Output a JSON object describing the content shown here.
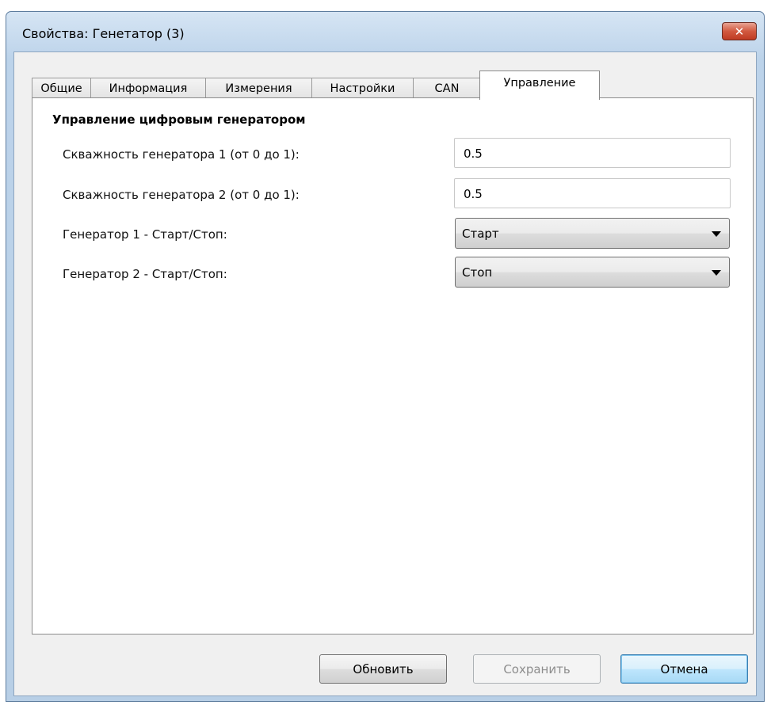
{
  "window": {
    "title": "Свойства: Генетатор (3)",
    "close_label": "✕"
  },
  "tabs": [
    {
      "label": "Общие"
    },
    {
      "label": "Информация"
    },
    {
      "label": "Измерения"
    },
    {
      "label": "Настройки"
    },
    {
      "label": "CAN"
    },
    {
      "label": "Управление",
      "active": true
    }
  ],
  "panel": {
    "section_title": "Управление цифровым генератором",
    "fields": [
      {
        "label": "Скважность генератора 1 (от 0 до 1):",
        "value": "0.5"
      },
      {
        "label": "Скважность генератора 2 (от 0 до 1):",
        "value": "0.5"
      },
      {
        "label": "Генератор 1 - Старт/Стоп:",
        "selected": "Старт"
      },
      {
        "label": "Генератор 2 - Старт/Стоп:",
        "selected": "Стоп"
      }
    ]
  },
  "buttons": {
    "refresh": "Обновить",
    "save": "Сохранить",
    "cancel": "Отмена"
  },
  "colors": {
    "title_bar": "#c5d9ee",
    "close_button": "#c7452d",
    "default_button": "#bee6fd"
  }
}
